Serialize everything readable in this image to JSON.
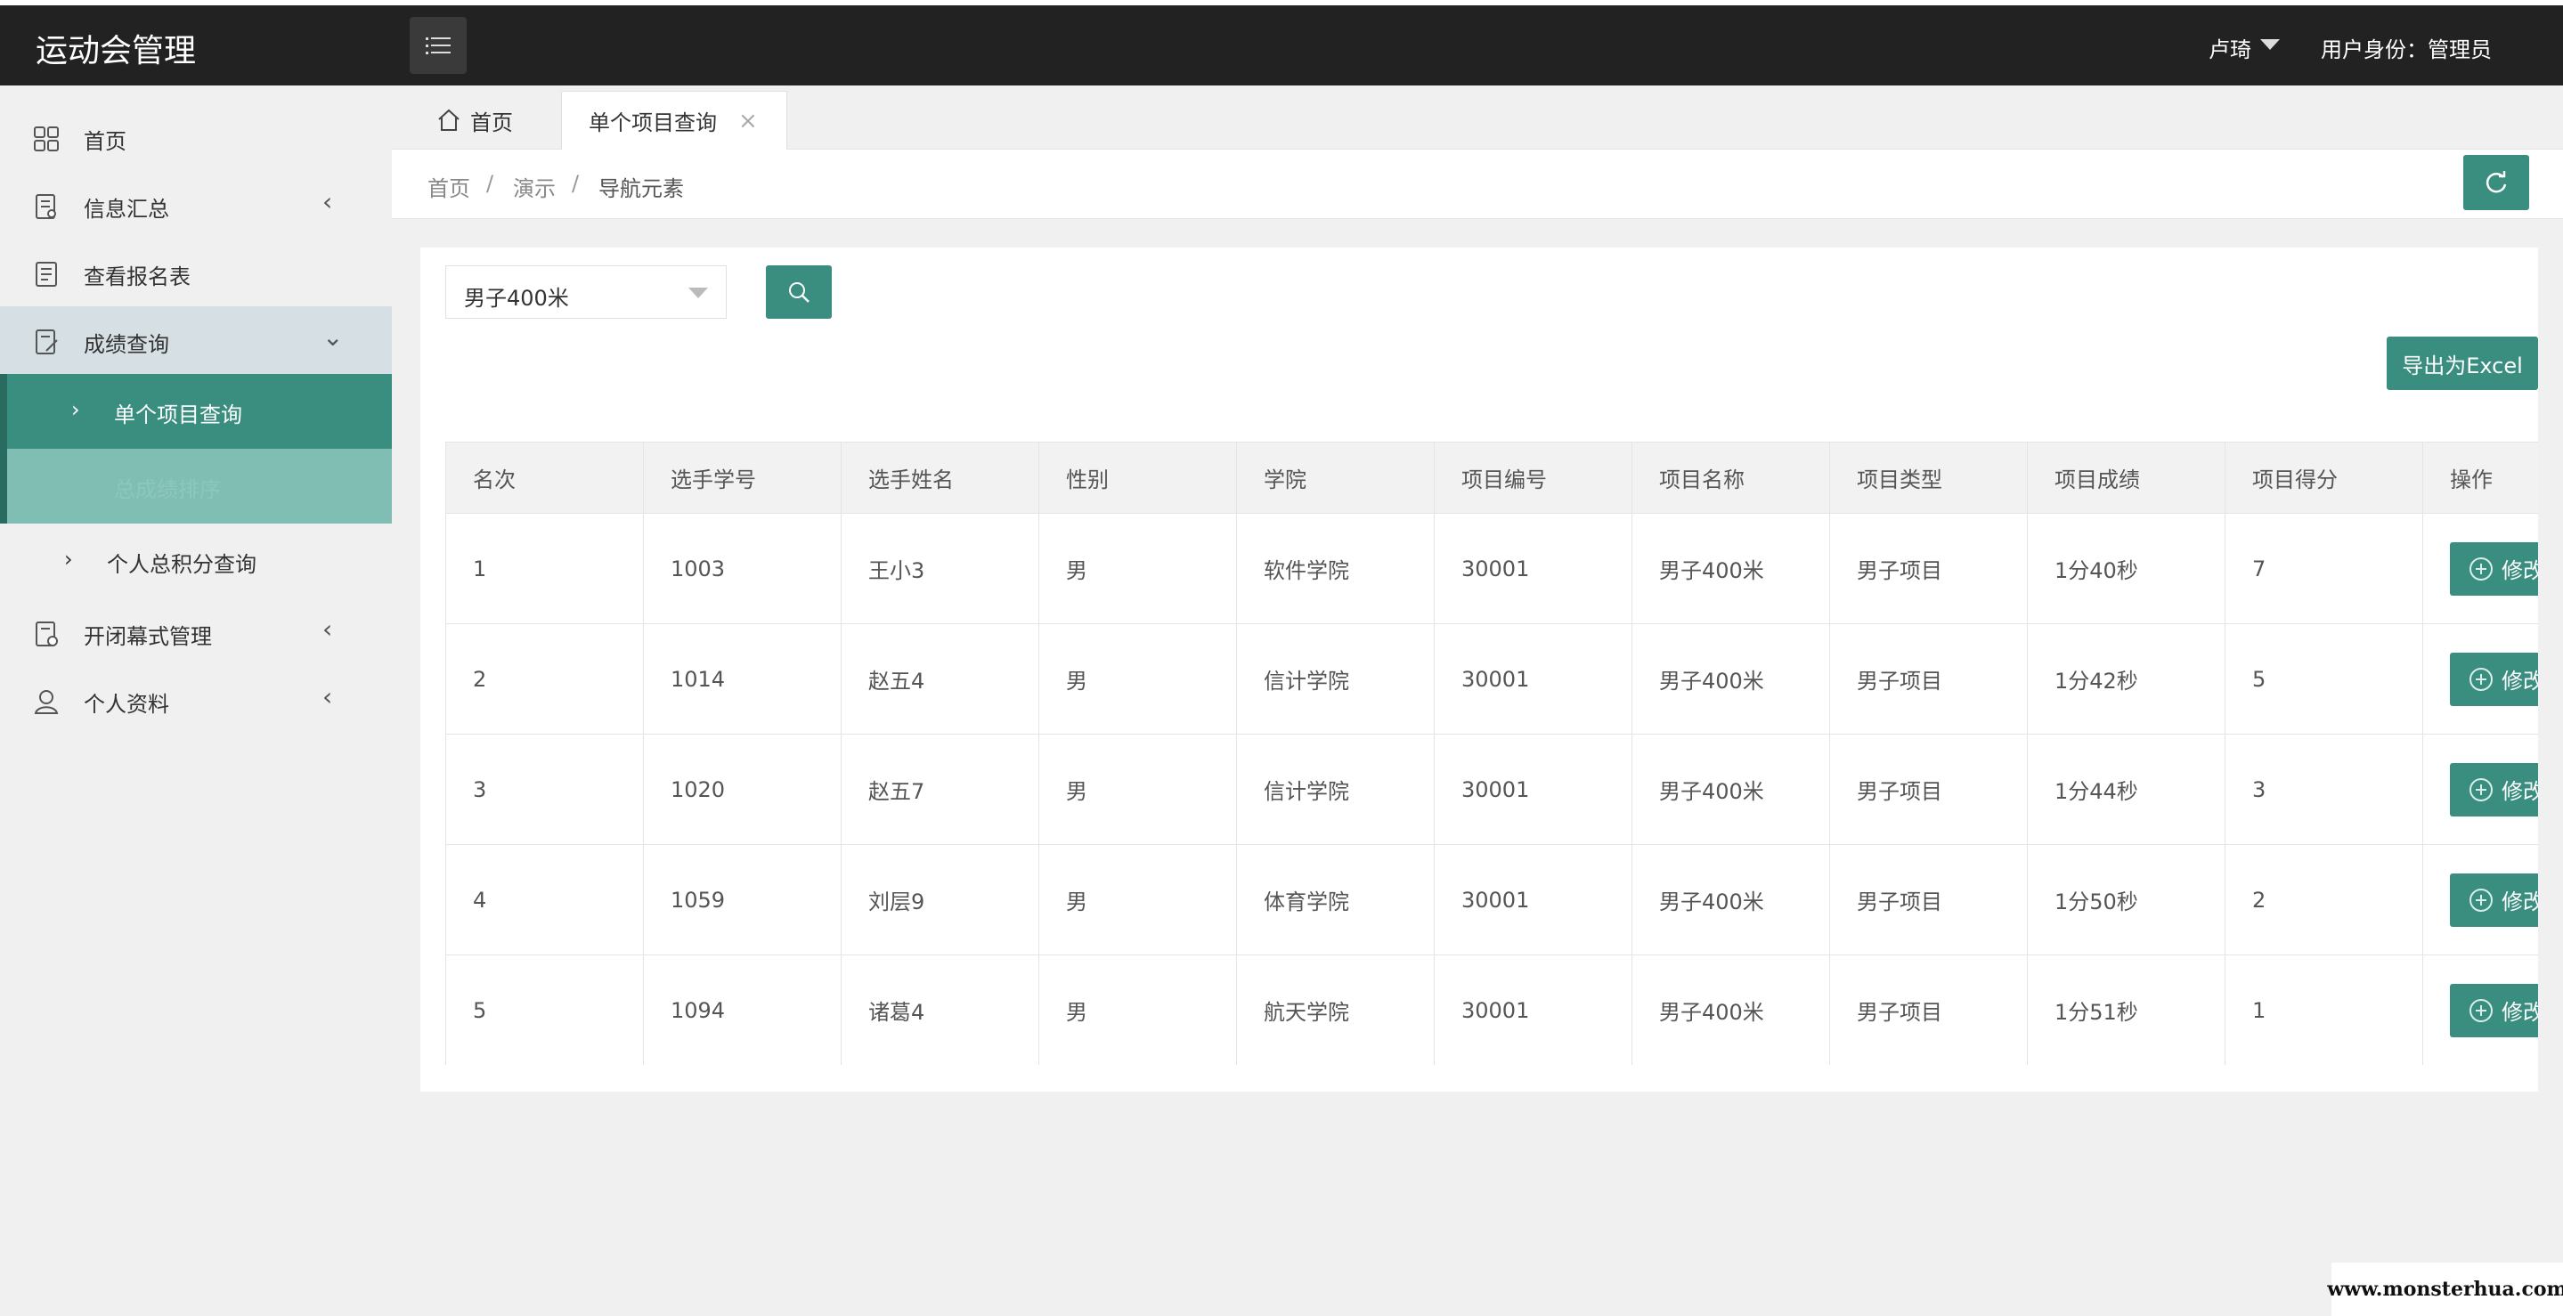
{
  "header": {
    "app_title": "运动会管理",
    "user_name": "卢琦",
    "user_role": "用户身份：管理员"
  },
  "sidebar": {
    "items": [
      {
        "label": "首页",
        "icon": "grid-icon"
      },
      {
        "label": "信息汇总",
        "icon": "document-icon",
        "chevron": "‹"
      },
      {
        "label": "查看报名表",
        "icon": "list-icon"
      },
      {
        "label": "成绩查询",
        "icon": "edit-document-icon",
        "chevron": "⌄"
      },
      {
        "label": "开闭幕式管理",
        "icon": "ceremony-icon",
        "chevron": "‹"
      },
      {
        "label": "个人资料",
        "icon": "user-icon",
        "chevron": "‹"
      }
    ],
    "subitems": [
      {
        "label": "单个项目查询",
        "arrow": "›"
      },
      {
        "label": "总成绩排序",
        "arrow": "›"
      },
      {
        "label": "个人总积分查询",
        "arrow": "›"
      }
    ]
  },
  "tabs": {
    "home": "首页",
    "active": "单个项目查询",
    "close": "×"
  },
  "breadcrumb": {
    "items": [
      "首页",
      "演示",
      "导航元素"
    ],
    "separator": "/"
  },
  "filter": {
    "selected": "男子400米"
  },
  "export_label": "导出为Excel",
  "table": {
    "headers": [
      "名次",
      "选手学号",
      "选手姓名",
      "性别",
      "学院",
      "项目编号",
      "项目名称",
      "项目类型",
      "项目成绩",
      "项目得分",
      "操作"
    ],
    "rows": [
      [
        "1",
        "1003",
        "王小3",
        "男",
        "软件学院",
        "30001",
        "男子400米",
        "男子项目",
        "1分40秒",
        "7"
      ],
      [
        "2",
        "1014",
        "赵五4",
        "男",
        "信计学院",
        "30001",
        "男子400米",
        "男子项目",
        "1分42秒",
        "5"
      ],
      [
        "3",
        "1020",
        "赵五7",
        "男",
        "信计学院",
        "30001",
        "男子400米",
        "男子项目",
        "1分44秒",
        "3"
      ],
      [
        "4",
        "1059",
        "刘层9",
        "男",
        "体育学院",
        "30001",
        "男子400米",
        "男子项目",
        "1分50秒",
        "2"
      ],
      [
        "5",
        "1094",
        "诸葛4",
        "男",
        "航天学院",
        "30001",
        "男子400米",
        "男子项目",
        "1分51秒",
        "1"
      ]
    ],
    "action_label": "修改"
  },
  "watermark": "www.monsterhua.com",
  "colors": {
    "accent": "#3a8e80",
    "header_bg": "#222222",
    "sidebar_active": "#3a8e80"
  }
}
